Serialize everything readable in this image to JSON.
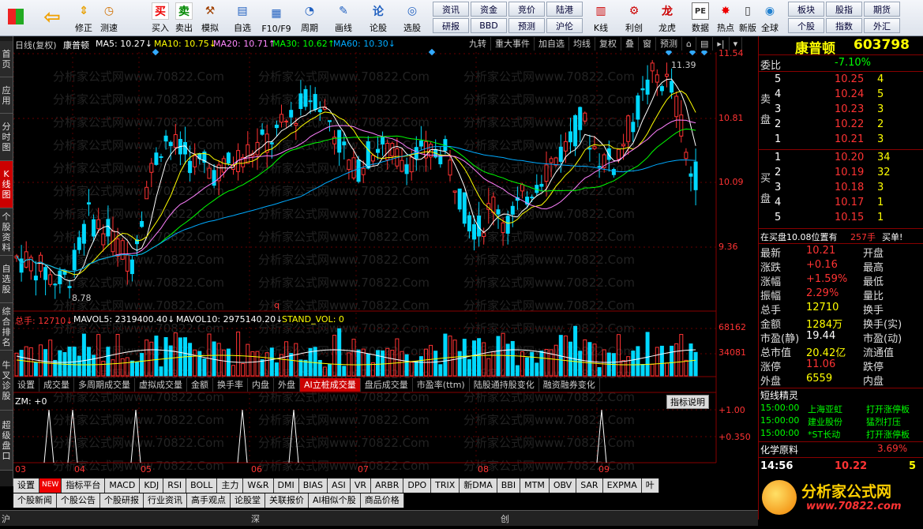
{
  "toolbar": {
    "buttons": [
      {
        "label": "",
        "icon": "grid-icon"
      },
      {
        "label": "",
        "icon": "back-arrow-icon"
      },
      {
        "label": "修正",
        "icon": "arrow-updown-icon"
      },
      {
        "label": "测速",
        "icon": "clock-icon"
      },
      {
        "label": "买入",
        "icon": "buy-icon"
      },
      {
        "label": "卖出",
        "icon": "sell-icon"
      },
      {
        "label": "模拟",
        "icon": "hammer-icon"
      },
      {
        "label": "自选",
        "icon": "folder-icon"
      },
      {
        "label": "F10/F9",
        "icon": "window-icon"
      },
      {
        "label": "周期",
        "icon": "clock-icon"
      },
      {
        "label": "画线",
        "icon": "pen-icon"
      },
      {
        "label": "论股",
        "icon": "chat-icon"
      },
      {
        "label": "选股",
        "icon": "chart-icon"
      }
    ],
    "grid_buttons": [
      "资讯",
      "资金",
      "竞价",
      "陆港",
      "研报",
      "BBD",
      "预测",
      "沪伦"
    ],
    "right_buttons": [
      {
        "label": "K线",
        "icon": "kline-icon"
      },
      {
        "label": "利创",
        "icon": "tools-icon"
      },
      {
        "label": "龙虎",
        "icon": "dragon-icon"
      },
      {
        "label": "数据",
        "icon": "pe-icon"
      },
      {
        "label": "热点",
        "icon": "hot-icon"
      },
      {
        "label": "新版",
        "icon": "phone-icon"
      },
      {
        "label": "全球",
        "icon": "globe-icon"
      }
    ],
    "right_grid": [
      "板块",
      "股指",
      "期货",
      "个股",
      "指数",
      "外汇"
    ]
  },
  "sidebar": [
    "首页",
    "应用",
    "分时图",
    "K线图",
    "个股资料",
    "自选股",
    "综合排名",
    "牛叉诊股",
    "超级盘口"
  ],
  "chart": {
    "title": "日线(复权)",
    "stock_name": "康普顿",
    "ma5": "MA5: 10.27↓",
    "ma10": "MA10: 10.75↓",
    "ma20": "MA20: 10.71↑",
    "ma30": "MA30: 10.62↑",
    "ma60": "MA60: 10.30↓",
    "top_tabs": [
      "九转",
      "重大事件",
      "加自选",
      "均线",
      "复权",
      "叠",
      "窗",
      "预测"
    ],
    "price_levels": [
      "11.54",
      "10.81",
      "10.09",
      "9.36"
    ],
    "high_label": "11.39",
    "low_label": "8.78",
    "vol_header": {
      "total": "总手: 12710↓",
      "mavol5": "MAVOL5: 2319400.40↓",
      "mavol10": "MAVOL10: 2975140.20↓",
      "stand": "STAND_VOL: 0"
    },
    "vol_levels": [
      "68162",
      "34081"
    ],
    "indicator_tabs": [
      "设置",
      "成交量",
      "多周期成交量",
      "虚拟成交量",
      "金额",
      "换手率",
      "内盘",
      "外盘",
      "AI立桩成交量",
      "盘后成交量",
      "市盈率(ttm)",
      "陆股通持股变化",
      "融资融券变化"
    ],
    "zm_label": "ZM: +0",
    "zm_button": "指标说明",
    "zm_levels": [
      "+1.00",
      "+0.350"
    ],
    "months": [
      "03",
      "04",
      "05",
      "06",
      "07",
      "08",
      "09"
    ],
    "q_marker": "q",
    "watermark": "分析家公式网www.70822.Com",
    "colors": {
      "up": "#ff3232",
      "down": "#00d8ff",
      "ma5": "#ffffff",
      "ma10": "#ffff00",
      "ma20": "#ff80ff",
      "ma30": "#00ff00",
      "ma60": "#00aaff"
    }
  },
  "bottom_tabs": [
    "设置",
    "NEW",
    "指标平台",
    "MACD",
    "KDJ",
    "RSI",
    "BOLL",
    "主力",
    "W&R",
    "DMI",
    "BIAS",
    "ASI",
    "VR",
    "ARBR",
    "DPO",
    "TRIX",
    "新DMA",
    "BBI",
    "MTM",
    "OBV",
    "SAR",
    "EXPMA",
    "叶"
  ],
  "bottom_tabs2": [
    "个股新闻",
    "个股公告",
    "个股研报",
    "行业资讯",
    "高手观点",
    "论股堂",
    "关联报价",
    "AI相似个股",
    "商品价格"
  ],
  "statusbar": [
    "沪",
    "深",
    "创"
  ],
  "panel": {
    "name": "康普顿",
    "code": "603798",
    "webi_label": "委比",
    "webi_value": "-7.10%",
    "sell_label": "卖盘",
    "buy_label": "买盘",
    "sell": [
      {
        "n": "5",
        "p": "10.25",
        "v": "4"
      },
      {
        "n": "4",
        "p": "10.24",
        "v": "5"
      },
      {
        "n": "3",
        "p": "10.23",
        "v": "3"
      },
      {
        "n": "2",
        "p": "10.22",
        "v": "2"
      },
      {
        "n": "1",
        "p": "10.21",
        "v": "3"
      }
    ],
    "buy": [
      {
        "n": "1",
        "p": "10.20",
        "v": "34"
      },
      {
        "n": "2",
        "p": "10.19",
        "v": "32"
      },
      {
        "n": "3",
        "p": "10.18",
        "v": "3"
      },
      {
        "n": "4",
        "p": "10.17",
        "v": "1"
      },
      {
        "n": "5",
        "p": "10.15",
        "v": "1"
      }
    ],
    "buy_note": "在买盘10.08位置有",
    "buy_note_vol": "257手",
    "buy_note_tag": "买单!",
    "stats": [
      [
        "最新",
        "10.21",
        "开盘",
        ""
      ],
      [
        "涨跌",
        "+0.16",
        "最高",
        ""
      ],
      [
        "涨幅",
        "+1.59%",
        "最低",
        ""
      ],
      [
        "振幅",
        "2.29%",
        "量比",
        ""
      ],
      [
        "总手",
        "12710",
        "换手",
        ""
      ],
      [
        "金额",
        "1284万",
        "换手(实)",
        ""
      ],
      [
        "市盈(静)",
        "19.44",
        "市盈(动)",
        ""
      ],
      [
        "总市值",
        "20.42亿",
        "流通值",
        ""
      ],
      [
        "涨停",
        "11.06",
        "跌停",
        ""
      ],
      [
        "外盘",
        "6559",
        "内盘",
        ""
      ]
    ],
    "short_title": "短线精灵",
    "short_items": [
      {
        "t": "15:00:00",
        "n": "上海亚虹",
        "s": "打开涨停板"
      },
      {
        "t": "15:00:00",
        "n": "建业股份",
        "s": "猛烈打压"
      },
      {
        "t": "15:00:00",
        "n": "*ST长动",
        "s": "打开涨停板"
      }
    ],
    "sector_name": "化学原料",
    "sector_change": "3.69%",
    "time": "14:56",
    "time_price": "10.22",
    "time_vol": "5",
    "logo_text": "分析家公式网",
    "logo_url": "www.70822.com"
  }
}
